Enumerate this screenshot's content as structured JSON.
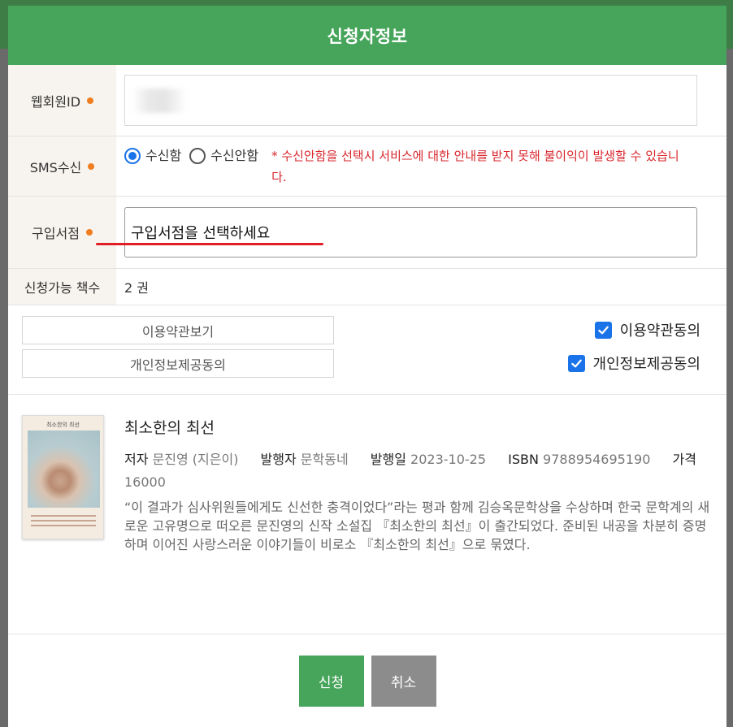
{
  "modal": {
    "title": "신청자정보"
  },
  "form": {
    "web_id_label": "웹회원ID",
    "sms_label": "SMS수신",
    "sms_options": [
      "수신함",
      "수신안함"
    ],
    "sms_selected": "수신함",
    "sms_note": "* 수신안함을 선택시 서비스에 대한 안내를 받지 못해 불이익이 발생할 수 있습니다.",
    "store_label": "구입서점",
    "store_placeholder": "구입서점을 선택하세요",
    "count_label": "신청가능 책수",
    "count_value": "2 권"
  },
  "agreements": {
    "terms_button": "이용약관보기",
    "privacy_button": "개인정보제공동의",
    "terms_check_label": "이용약관동의",
    "privacy_check_label": "개인정보제공동의",
    "terms_checked": true,
    "privacy_checked": true
  },
  "book": {
    "cover_title": "최소한의 최선",
    "title": "최소한의 최선",
    "author_label": "저자",
    "author": "문진영 (지은이)",
    "publisher_label": "발행자",
    "publisher": "문학동네",
    "date_label": "발행일",
    "date": "2023-10-25",
    "isbn_label": "ISBN",
    "isbn": "9788954695190",
    "price_label": "가격",
    "price": "16000",
    "description": "“이 결과가 심사위원들에게도 신선한 충격이었다”라는 평과 함께 김승옥문학상을 수상하며 한국 문학계의 새로운 고유명으로 떠오른 문진영의 신작 소설집 『최소한의 최선』이 출간되었다. 준비된 내공을 차분히 증명하며 이어진 사랑스러운 이야기들이 비로소 『최소한의 최선』으로 묶였다."
  },
  "buttons": {
    "apply": "신청",
    "cancel": "취소"
  },
  "colors": {
    "header": "#47a55b",
    "accent_dot": "#f07d1f",
    "note_red": "#d9262c",
    "checkbox_blue": "#1a73e8",
    "cancel_gray": "#8c8c8c"
  }
}
